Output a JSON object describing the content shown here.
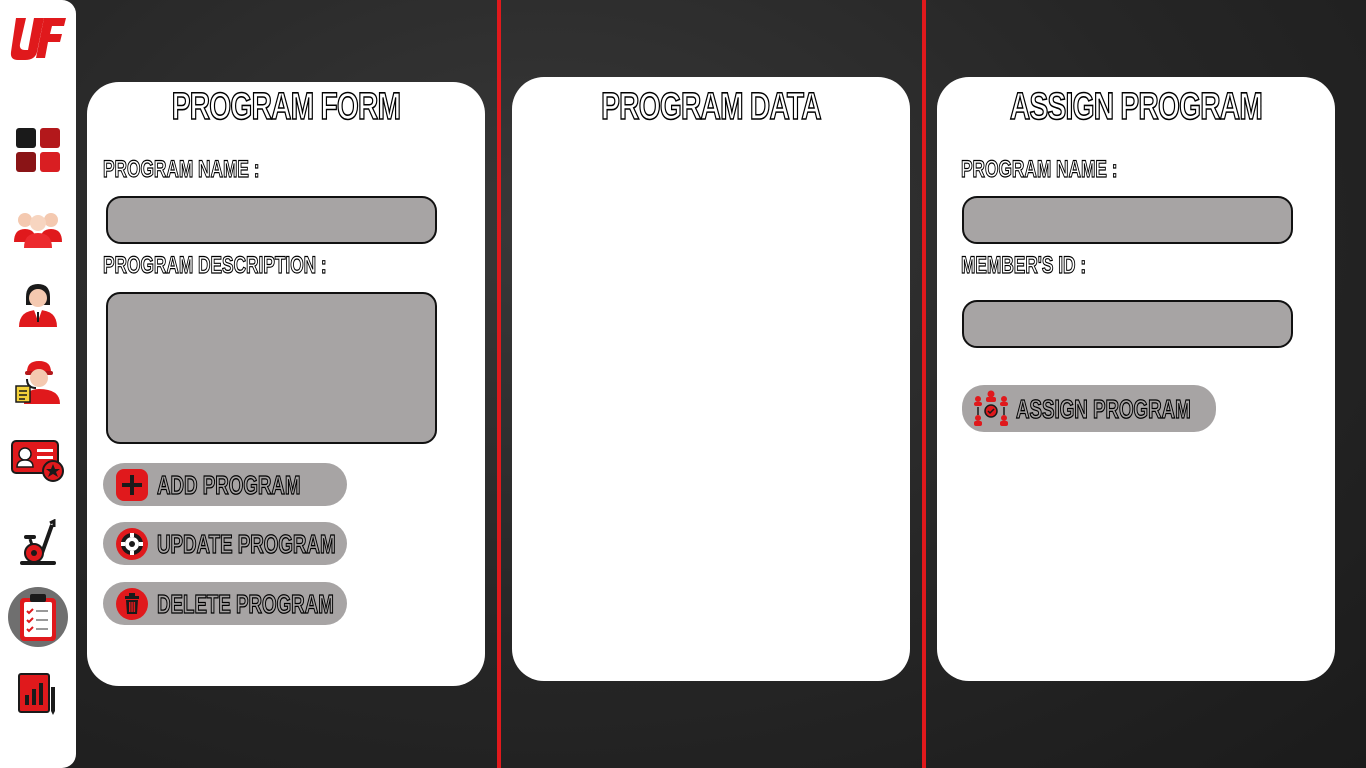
{
  "brand": {
    "logo_text": "UF",
    "accent": "#e0191c"
  },
  "sidebar": {
    "items": [
      {
        "name": "dashboard",
        "icon": "dashboard-grid-icon",
        "active": false
      },
      {
        "name": "members",
        "icon": "members-group-icon",
        "active": false
      },
      {
        "name": "staff",
        "icon": "staff-person-icon",
        "active": false
      },
      {
        "name": "trainers",
        "icon": "trainer-headset-icon",
        "active": false
      },
      {
        "name": "membership",
        "icon": "member-card-icon",
        "active": false
      },
      {
        "name": "equipment",
        "icon": "exercise-bike-icon",
        "active": false
      },
      {
        "name": "programs",
        "icon": "clipboard-checklist-icon",
        "active": true
      },
      {
        "name": "reports",
        "icon": "report-chart-icon",
        "active": false
      }
    ]
  },
  "program_form": {
    "title": "PROGRAM FORM",
    "name_label": "PROGRAM NAME :",
    "name_value": "",
    "description_label": "PROGRAM DESCRIPTION :",
    "description_value": "",
    "add_label": "ADD PROGRAM",
    "update_label": "UPDATE PROGRAM",
    "delete_label": "DELETE PROGRAM"
  },
  "program_data": {
    "title": "PROGRAM DATA"
  },
  "assign_program": {
    "title": "ASSIGN PROGRAM",
    "name_label": "PROGRAM NAME :",
    "name_value": "",
    "member_label": "MEMBER'S ID :",
    "member_value": "",
    "assign_label": "ASSIGN PROGRAM"
  }
}
